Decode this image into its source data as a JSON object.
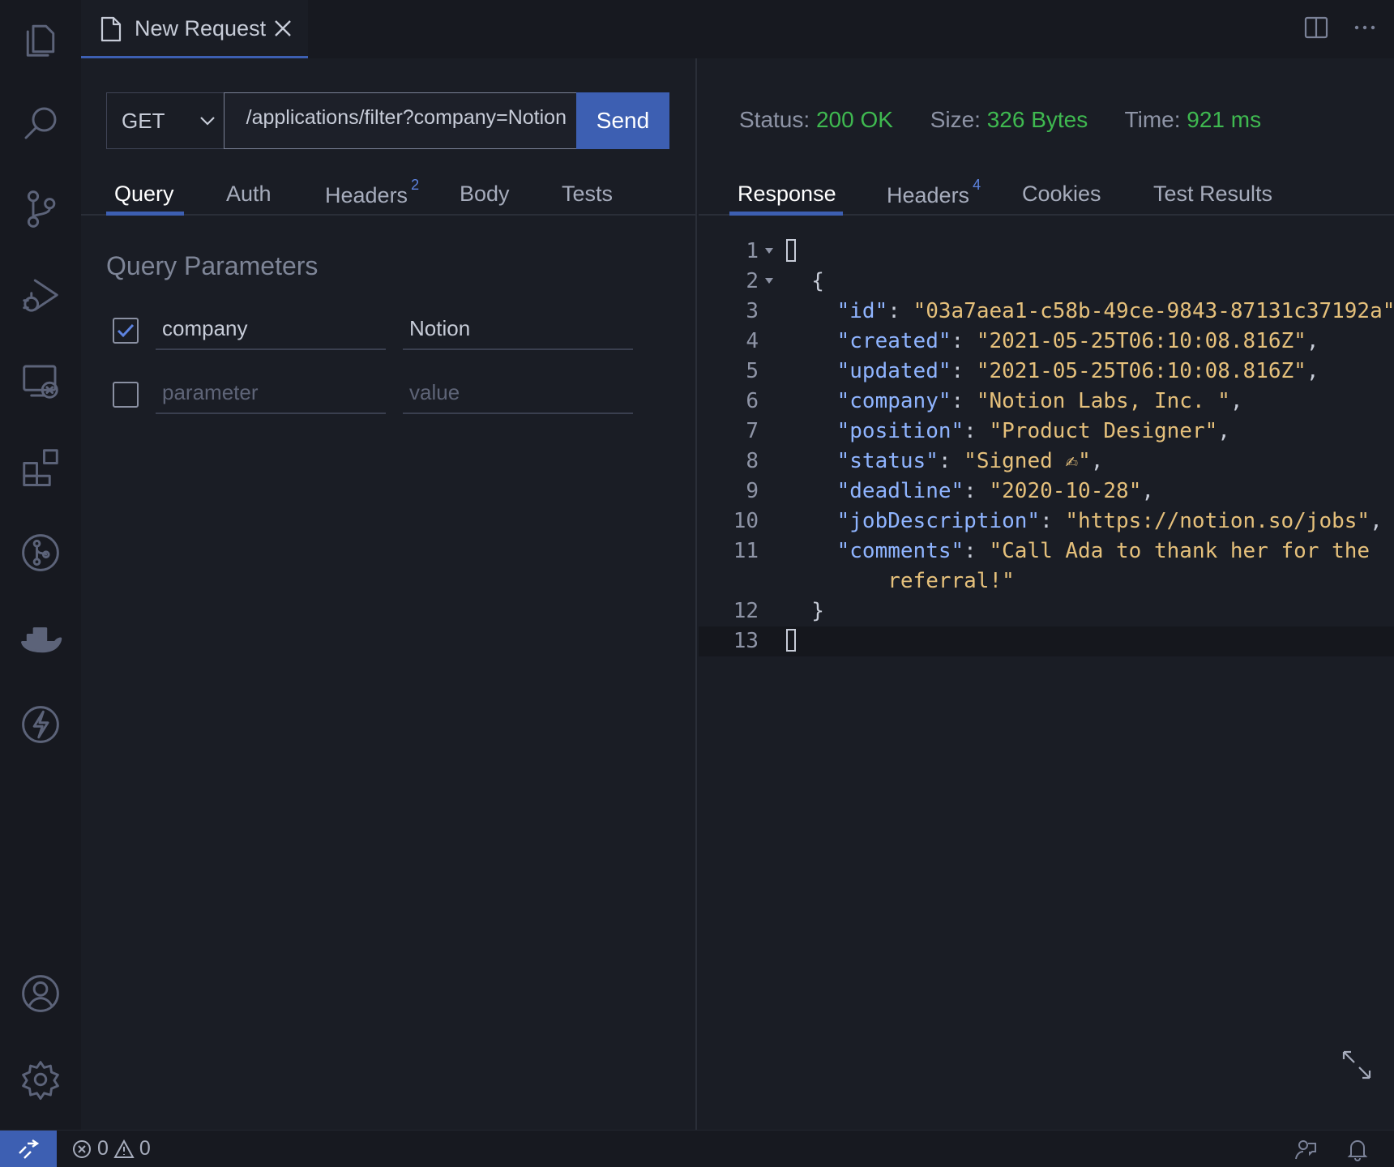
{
  "tab": {
    "title": "New Request"
  },
  "request": {
    "method": "GET",
    "url": "/applications/filter?company=Notion",
    "send_label": "Send",
    "tabs": [
      {
        "label": "Query",
        "badge": ""
      },
      {
        "label": "Auth",
        "badge": ""
      },
      {
        "label": "Headers",
        "badge": "2"
      },
      {
        "label": "Body",
        "badge": ""
      },
      {
        "label": "Tests",
        "badge": ""
      }
    ],
    "active_tab": "Query",
    "query_title": "Query Parameters",
    "params": [
      {
        "checked": true,
        "name": "company",
        "value": "Notion"
      }
    ],
    "new_param": {
      "name_placeholder": "parameter",
      "value_placeholder": "value"
    }
  },
  "response": {
    "status_label": "Status:",
    "status_value": "200 OK",
    "size_label": "Size:",
    "size_value": "326 Bytes",
    "time_label": "Time:",
    "time_value": "921 ms",
    "tabs": [
      {
        "label": "Response",
        "badge": ""
      },
      {
        "label": "Headers",
        "badge": "4"
      },
      {
        "label": "Cookies",
        "badge": ""
      },
      {
        "label": "Test Results",
        "badge": ""
      }
    ],
    "active_tab": "Response",
    "body": {
      "id": "03a7aea1-c58b-49ce-9843-87131c37192a",
      "created": "2021-05-25T06:10:08.816Z",
      "updated": "2021-05-25T06:10:08.816Z",
      "company": "Notion Labs, Inc. ",
      "position": "Product Designer",
      "status": "Signed ✍",
      "deadline": "2020-10-28",
      "jobDescription": "https://notion.so/jobs",
      "comments_line1": "Call Ada to thank her for the",
      "comments_line2": "referral!"
    }
  },
  "statusbar": {
    "errors": "0",
    "warnings": "0"
  },
  "colors": {
    "accent": "#3d5fb2",
    "success": "#3fb950",
    "json_key": "#8fb4ff",
    "json_string": "#e5c07b"
  },
  "icons": [
    "explorer-icon",
    "search-icon",
    "source-control-icon",
    "run-debug-icon",
    "remote-explorer-icon",
    "extensions-icon",
    "git-graph-icon",
    "docker-icon",
    "thunder-client-icon",
    "account-icon",
    "settings-gear-icon"
  ]
}
